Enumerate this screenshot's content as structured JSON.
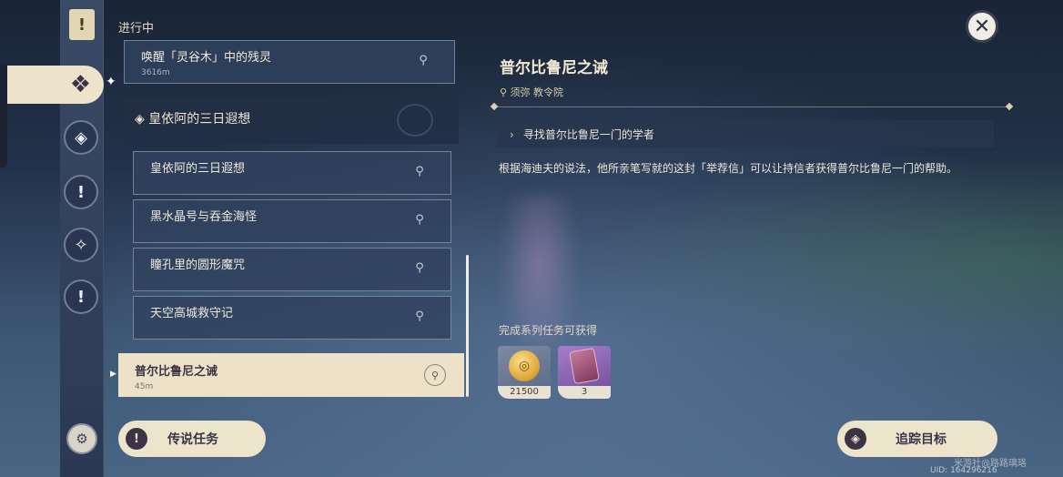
{
  "list_section_title": "进行中",
  "quests": [
    {
      "name": "唤醒「灵谷木」中的残灵",
      "distance": "3616m"
    },
    {
      "name": "皇依阿的三日遐想",
      "distance": ""
    },
    {
      "name": "黑水晶号与吞金海怪",
      "distance": ""
    },
    {
      "name": "瞳孔里的圆形魔咒",
      "distance": ""
    },
    {
      "name": "天空高城救守记",
      "distance": ""
    }
  ],
  "group_header": "皇依阿的三日遐想",
  "selected_quest": {
    "name": "普尔比鲁尼之诫",
    "distance": "45m"
  },
  "detail": {
    "title": "普尔比鲁尼之诫",
    "location": "须弥 教令院",
    "objective": "寻找普尔比鲁尼一门的学者",
    "description": "根据海迪夫的说法，他所亲笔写就的这封「举荐信」可以让持信者获得普尔比鲁尼一门的帮助。",
    "reward_title": "完成系列任务可获得",
    "rewards": [
      {
        "icon": "mora-coin-icon",
        "count": "21500"
      },
      {
        "icon": "book-card-icon",
        "count": "3"
      }
    ]
  },
  "buttons": {
    "legend_quest": "传说任务",
    "track_target": "追踪目标"
  },
  "watermark": "米游社@路路璃珞",
  "uid": "UID: 164296216"
}
